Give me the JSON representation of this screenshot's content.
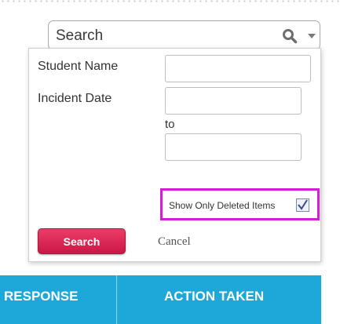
{
  "search_bar": {
    "text": "Search",
    "search_icon": "magnifier-icon",
    "dropdown_icon": "caret-down-icon"
  },
  "filter_panel": {
    "student_name_label": "Student Name",
    "student_name_value": "",
    "incident_date_label": "Incident Date",
    "date_from_value": "",
    "to_label": "to",
    "date_to_value": "",
    "show_deleted_label": "Show Only Deleted Items",
    "show_deleted_checked": true,
    "search_button_label": "Search",
    "cancel_label": "Cancel"
  },
  "table_header": {
    "columns": [
      "RESPONSE",
      "ACTION TAKEN"
    ]
  },
  "colors": {
    "header_blue": "#1ea7d9",
    "search_button": "#d81b4f",
    "highlight_box": "#d21fd2"
  }
}
